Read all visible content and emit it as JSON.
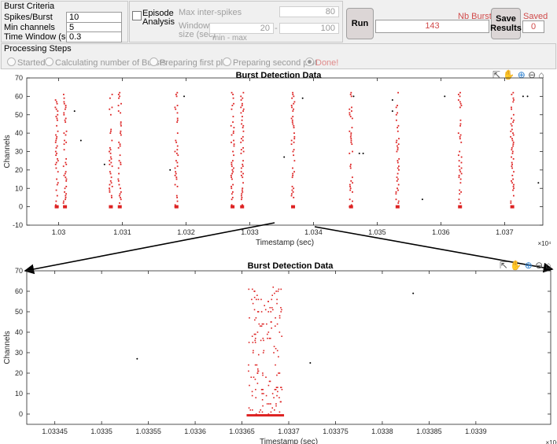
{
  "burst_criteria": {
    "title": "Burst Criteria",
    "fields": [
      {
        "label": "Spikes/Burst",
        "value": "10"
      },
      {
        "label": "Min channels",
        "value": "5"
      },
      {
        "label": "Time Window (sec)",
        "value": "0.3"
      }
    ]
  },
  "episode": {
    "checkbox_label_1": "Episode",
    "checkbox_label_2": "Analysis",
    "checked": false,
    "max_inter_spikes_label": "Max inter-spikes",
    "max_inter_spikes_value": "80",
    "window_size_label_1": "Window",
    "window_size_label_2": "size (sec)",
    "window_min": "20",
    "window_dash": "-",
    "window_max": "100",
    "min_max_label": "min  -  max"
  },
  "actions": {
    "run_label": "Run",
    "nb_bursts_label": "Nb Bursts",
    "nb_bursts_value": "143",
    "save_label_1": "Save",
    "save_label_2": "Results",
    "saved_label": "Saved",
    "saved_value": "0"
  },
  "processing": {
    "title": "Processing Steps",
    "steps": [
      {
        "label": "Started",
        "selected": false
      },
      {
        "label": "Calculating number of Bursts",
        "selected": false
      },
      {
        "label": "Preparing first plot",
        "selected": false
      },
      {
        "label": "Preparing second plot",
        "selected": false
      },
      {
        "label": "Done!",
        "selected": true
      }
    ]
  },
  "colors": {
    "spike": "#dd2222",
    "nonburst": "#000000",
    "accent_red": "#d04a4a",
    "panel": "#f0f0f0"
  },
  "toolbar_icons": [
    "export-icon",
    "pan-hand-icon",
    "zoom-in-icon",
    "zoom-out-icon",
    "home-icon"
  ],
  "chart_data": [
    {
      "type": "scatter",
      "title": "Burst Detection Data",
      "xlabel": "Timestamp (sec)",
      "ylabel": "Channels",
      "x_multiplier": "×10⁴",
      "xlim": [
        10295,
        10376
      ],
      "ylim": [
        -10,
        70
      ],
      "xticks": [
        10300,
        10310,
        10320,
        10330,
        10340,
        10350,
        10360,
        10370
      ],
      "xtick_labels": [
        "1.03",
        "1.031",
        "1.032",
        "1.033",
        "1.034",
        "1.035",
        "1.036",
        "1.037"
      ],
      "yticks": [
        -10,
        0,
        10,
        20,
        30,
        40,
        50,
        60,
        70
      ],
      "burst_times_sec": [
        10299.7,
        10301.0,
        10308.2,
        10309.6,
        10318.5,
        10327.3,
        10328.8,
        10336.8,
        10345.9,
        10353.2,
        10363.0,
        10371.2
      ],
      "nonburst_points": [
        {
          "x": 10302.5,
          "y": 52
        },
        {
          "x": 10303.5,
          "y": 36
        },
        {
          "x": 10307.2,
          "y": 23
        },
        {
          "x": 10317.5,
          "y": 20
        },
        {
          "x": 10319.7,
          "y": 60
        },
        {
          "x": 10335.4,
          "y": 27
        },
        {
          "x": 10338.3,
          "y": 59
        },
        {
          "x": 10346.3,
          "y": 60
        },
        {
          "x": 10347.2,
          "y": 29
        },
        {
          "x": 10347.8,
          "y": 29
        },
        {
          "x": 10352.4,
          "y": 58
        },
        {
          "x": 10352.4,
          "y": 52
        },
        {
          "x": 10357.1,
          "y": 4
        },
        {
          "x": 10360.6,
          "y": 60
        },
        {
          "x": 10372.9,
          "y": 60
        },
        {
          "x": 10373.6,
          "y": 60
        },
        {
          "x": 10375.3,
          "y": 13
        }
      ],
      "grid": false
    },
    {
      "type": "scatter",
      "title": "Burst Detection Data",
      "xlabel": "Timestamp (sec)",
      "ylabel": "Channels",
      "x_multiplier": "×10⁴",
      "xlim": [
        10334.2,
        10339.8
      ],
      "ylim": [
        -5,
        70
      ],
      "xticks": [
        10334.5,
        10335.0,
        10335.5,
        10336.0,
        10336.5,
        10337.0,
        10337.5,
        10338.0,
        10338.5,
        10339.0
      ],
      "xtick_labels": [
        "1.03345",
        "1.0335",
        "1.03355",
        "1.0336",
        "1.03365",
        "1.0337",
        "1.03375",
        "1.0338",
        "1.03385",
        "1.0339"
      ],
      "yticks": [
        0,
        10,
        20,
        30,
        40,
        50,
        60,
        70
      ],
      "burst_span_sec": [
        10336.55,
        10336.95
      ],
      "nonburst_points": [
        {
          "x": 10335.38,
          "y": 27
        },
        {
          "x": 10337.23,
          "y": 25
        },
        {
          "x": 10338.33,
          "y": 59
        }
      ],
      "grid": false
    }
  ]
}
